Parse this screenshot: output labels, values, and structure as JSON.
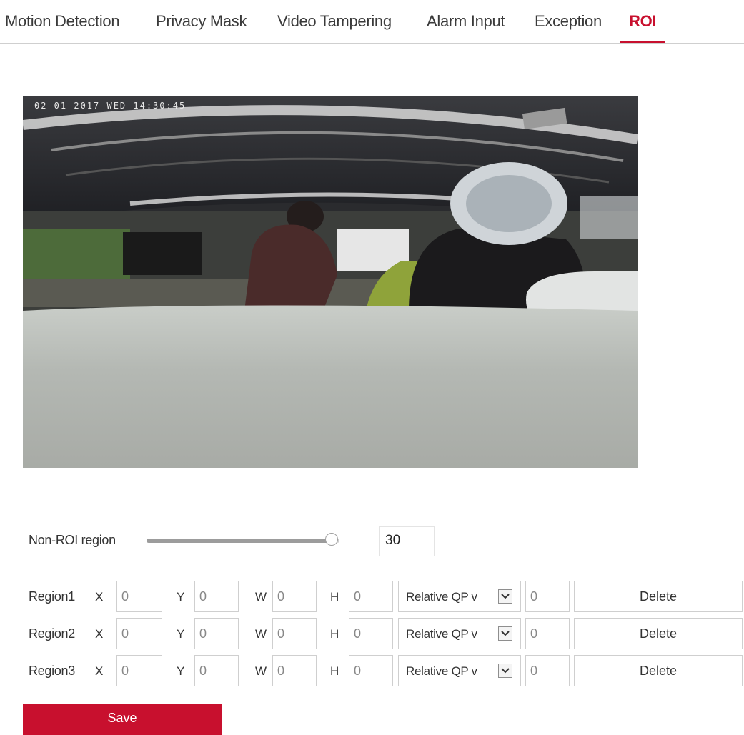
{
  "tabs": [
    {
      "label": "Motion Detection",
      "active": false
    },
    {
      "label": "Privacy Mask",
      "active": false
    },
    {
      "label": "Video Tampering",
      "active": false
    },
    {
      "label": "Alarm Input",
      "active": false
    },
    {
      "label": "Exception",
      "active": false
    },
    {
      "label": "ROI",
      "active": true
    }
  ],
  "preview": {
    "osd_text": "02-01-2017 WED 14:30:45"
  },
  "non_roi": {
    "label": "Non-ROI region",
    "value": "30",
    "slider_fraction": 0.96
  },
  "regions": [
    {
      "label": "Region1",
      "x_label": "X",
      "x": "0",
      "y_label": "Y",
      "y": "0",
      "w_label": "W",
      "w": "0",
      "h_label": "H",
      "h": "0",
      "qp_mode": "Relative QP v",
      "qp_value": "0",
      "delete_label": "Delete"
    },
    {
      "label": "Region2",
      "x_label": "X",
      "x": "0",
      "y_label": "Y",
      "y": "0",
      "w_label": "W",
      "w": "0",
      "h_label": "H",
      "h": "0",
      "qp_mode": "Relative QP v",
      "qp_value": "0",
      "delete_label": "Delete"
    },
    {
      "label": "Region3",
      "x_label": "X",
      "x": "0",
      "y_label": "Y",
      "y": "0",
      "w_label": "W",
      "w": "0",
      "h_label": "H",
      "h": "0",
      "qp_mode": "Relative QP v",
      "qp_value": "0",
      "delete_label": "Delete"
    }
  ],
  "actions": {
    "save_label": "Save"
  },
  "colors": {
    "accent": "#c8102e",
    "border": "#cfcfcf",
    "text": "#333333"
  },
  "icons": {
    "select_arrow": "chevron-down-icon",
    "slider_thumb": "slider-handle"
  }
}
